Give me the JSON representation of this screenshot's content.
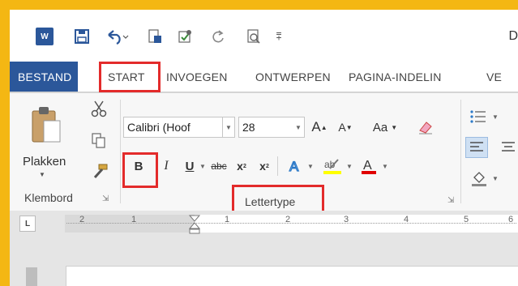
{
  "quick_access": {
    "app_icon_label": "W",
    "save_tooltip": "Opslaan",
    "title_fragment": "D"
  },
  "tabs": [
    {
      "label": "BESTAND",
      "active": false
    },
    {
      "label": "START",
      "active": true,
      "highlighted": true
    },
    {
      "label": "INVOEGEN",
      "active": false
    },
    {
      "label": "ONTWERPEN",
      "active": false
    },
    {
      "label": "PAGINA-INDELIN",
      "active": false
    },
    {
      "label": "VE",
      "active": false
    }
  ],
  "clipboard": {
    "paste_label": "Plakken",
    "group_label": "Klembord"
  },
  "font": {
    "font_name": "Calibri (Hoof",
    "font_size": "28",
    "grow": "A",
    "shrink": "A",
    "case_label": "Aa",
    "bold": "B",
    "italic": "I",
    "underline": "U",
    "strike": "abc",
    "sub": "x",
    "sup": "x",
    "group_label": "Lettertype"
  },
  "ruler": {
    "tab_selector": "L",
    "labels": [
      "2",
      "1",
      "1",
      "2",
      "3",
      "4",
      "5",
      "6"
    ]
  },
  "colors": {
    "brand_blue": "#2b579a",
    "highlight_red": "#e32b2b",
    "frame_gold": "#f4b713"
  }
}
